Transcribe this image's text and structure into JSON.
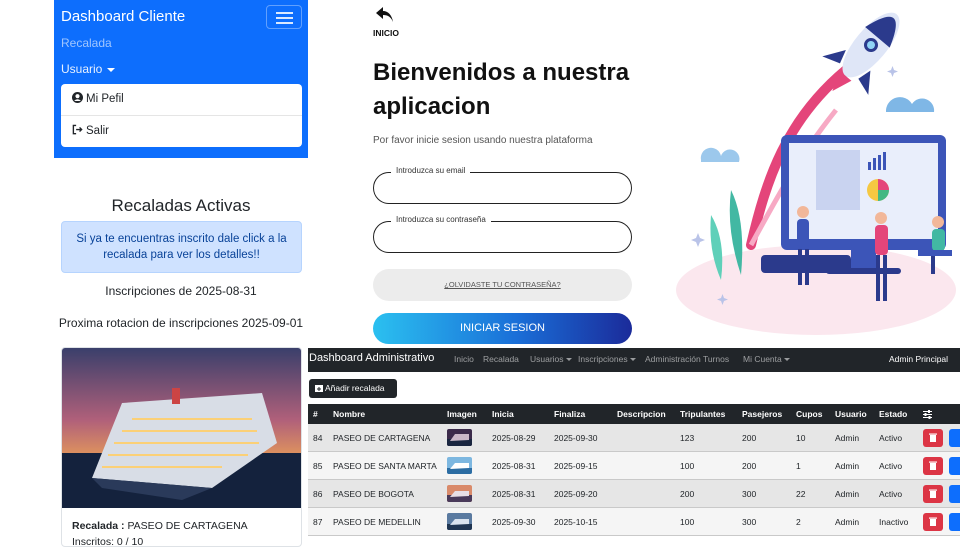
{
  "client": {
    "brand": "Dashboard Cliente",
    "nav_recalada": "Recalada",
    "nav_usuario": "Usuario",
    "menu": [
      {
        "label": "Mi Pefil",
        "icon": "user-circle-icon"
      },
      {
        "label": "Salir",
        "icon": "sign-out-icon"
      }
    ],
    "title": "Recaladas Activas",
    "alert": "Si ya te encuentras inscrito dale click a la recalada para ver los detalles!!",
    "inscripciones": "Inscripciones de 2025-08-31",
    "proxima": "Proxima rotacion de inscripciones 2025-09-01",
    "card": {
      "label": "Recalada :",
      "value": "PASEO DE CARTAGENA",
      "sub": "Inscritos: 0 / 10"
    }
  },
  "login": {
    "back_label": "INICIO",
    "welcome": "Bienvenidos a nuestra aplicacion",
    "subtitle": "Por favor inicie sesion usando nuestra plataforma",
    "email_label": "Introduzca su email",
    "password_label": "Introduzca su contraseña",
    "forgot": "¿OLVIDASTE TU CONTRASEÑA?",
    "submit": "INICIAR SESION",
    "colors": {
      "gradient_start": "#2bc0f0",
      "gradient_end": "#1b2b9a"
    }
  },
  "admin": {
    "brand": "Dashboard Administrativo",
    "nav": [
      "Inicio",
      "Recalada",
      "Usuarios",
      "Inscripciones",
      "Administración Turnos",
      "Mi Cuenta"
    ],
    "user": "Admin Principal",
    "add_button": "Añadir recalada",
    "columns": [
      "#",
      "Nombre",
      "Imagen",
      "Inicia",
      "Finaliza",
      "Descripcion",
      "Tripulantes",
      "Pasejeros",
      "Cupos",
      "Usuario",
      "Estado"
    ],
    "rows": [
      {
        "id": "84",
        "nombre": "PASEO DE CARTAGENA",
        "inicia": "2025-08-29",
        "finaliza": "2025-09-30",
        "descripcion": "",
        "tripulantes": "123",
        "pasajeros": "200",
        "cupos": "10",
        "usuario": "Admin",
        "estado": "Activo"
      },
      {
        "id": "85",
        "nombre": "PASEO DE SANTA MARTA",
        "inicia": "2025-08-31",
        "finaliza": "2025-09-15",
        "descripcion": "",
        "tripulantes": "100",
        "pasajeros": "200",
        "cupos": "1",
        "usuario": "Admin",
        "estado": "Activo"
      },
      {
        "id": "86",
        "nombre": "PASEO DE BOGOTA",
        "inicia": "2025-08-31",
        "finaliza": "2025-09-20",
        "descripcion": "",
        "tripulantes": "200",
        "pasajeros": "300",
        "cupos": "22",
        "usuario": "Admin",
        "estado": "Activo"
      },
      {
        "id": "87",
        "nombre": "PASEO DE MEDELLIN",
        "inicia": "2025-09-30",
        "finaliza": "2025-10-15",
        "descripcion": "",
        "tripulantes": "100",
        "pasajeros": "300",
        "cupos": "2",
        "usuario": "Admin",
        "estado": "Inactivo"
      }
    ]
  }
}
